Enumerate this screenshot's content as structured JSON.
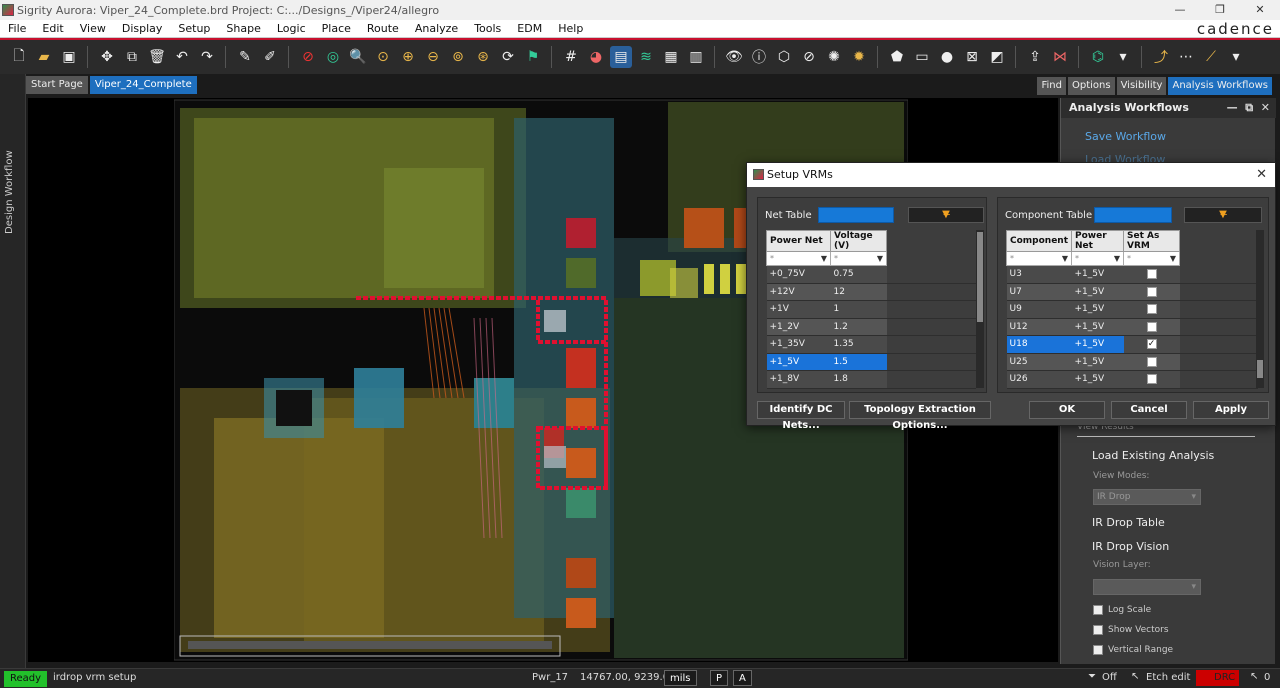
{
  "window": {
    "title": "Sigrity Aurora: Viper_24_Complete.brd  Project: C:.../Designs_/Viper24/allegro"
  },
  "menu": [
    "File",
    "Edit",
    "View",
    "Display",
    "Setup",
    "Shape",
    "Logic",
    "Place",
    "Route",
    "Analyze",
    "Tools",
    "EDM",
    "Help"
  ],
  "brand": "cadence",
  "left_strip_label": "Design Workflow",
  "tabs": [
    "Start Page",
    "Viper_24_Complete"
  ],
  "right_tabs": [
    "Find",
    "Options",
    "Visibility",
    "Analysis Workflows"
  ],
  "panel": {
    "title": "Analysis Workflows",
    "save_workflow": "Save Workflow",
    "load_workflow": "Load Workflow",
    "view_results": "View Results",
    "load_existing": "Load Existing Analysis",
    "view_modes_label": "View Modes:",
    "view_modes_value": "IR Drop",
    "ir_drop_table": "IR Drop Table",
    "ir_drop_vision": "IR Drop Vision",
    "vision_layer_label": "Vision Layer:",
    "vision_layer_value": "",
    "log_scale": "Log Scale",
    "show_vectors": "Show Vectors",
    "vertical_range": "Vertical Range"
  },
  "dialog": {
    "title": "Setup VRMs",
    "net_table_label": "Net Table",
    "component_table_label": "Component Table",
    "filter_placeholder": "*",
    "net_columns": [
      "Power Net",
      "Voltage (V)"
    ],
    "net_rows": [
      {
        "net": "+0_75V",
        "voltage": "0.75"
      },
      {
        "net": "+12V",
        "voltage": "12"
      },
      {
        "net": "+1V",
        "voltage": "1"
      },
      {
        "net": "+1_2V",
        "voltage": "1.2"
      },
      {
        "net": "+1_35V",
        "voltage": "1.35"
      },
      {
        "net": "+1_5V",
        "voltage": "1.5",
        "selected": true
      },
      {
        "net": "+1_8V",
        "voltage": "1.8"
      }
    ],
    "comp_columns": [
      "Component",
      "Power Net",
      "Set As VRM"
    ],
    "comp_rows": [
      {
        "comp": "U3",
        "net": "+1_5V",
        "vrm": false
      },
      {
        "comp": "U7",
        "net": "+1_5V",
        "vrm": false
      },
      {
        "comp": "U9",
        "net": "+1_5V",
        "vrm": false
      },
      {
        "comp": "U12",
        "net": "+1_5V",
        "vrm": false
      },
      {
        "comp": "U18",
        "net": "+1_5V",
        "vrm": true,
        "selected": true
      },
      {
        "comp": "U25",
        "net": "+1_5V",
        "vrm": false
      },
      {
        "comp": "U26",
        "net": "+1_5V",
        "vrm": false
      }
    ],
    "buttons": {
      "identify_dc": "Identify DC Nets...",
      "topology": "Topology Extraction Options...",
      "ok": "OK",
      "cancel": "Cancel",
      "apply": "Apply"
    }
  },
  "status": {
    "ready": "Ready",
    "command": "irdrop vrm setup",
    "layer": "Pwr_17",
    "coords": "14767.00, 9239.00",
    "units": "mils",
    "p": "P",
    "a": "A",
    "off": "Off",
    "etch_edit": "Etch edit",
    "drc": "DRC",
    "count": "0"
  },
  "colors": {
    "accent": "#1e6fbf",
    "ready": "#22c12b",
    "brand_red": "#c8102e",
    "drc": "#cc0000"
  }
}
